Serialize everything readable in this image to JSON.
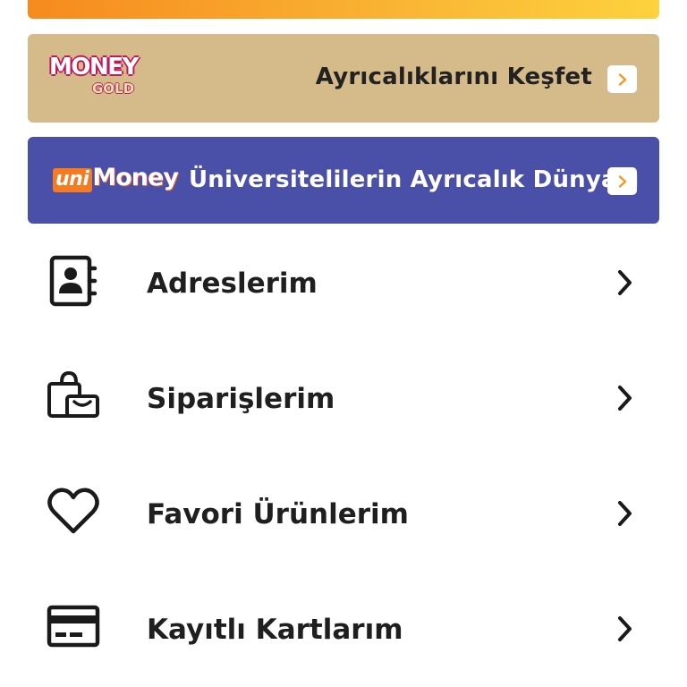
{
  "colors": {
    "gold_banner": "#d5bb8a",
    "uni_banner": "#4a4fa8",
    "accent_orange": "#f68a1e",
    "text_dark": "#1f1f1f"
  },
  "gold_promo": {
    "logo_main": "MONEY",
    "logo_sub": "GOLD",
    "text": "Ayrıcalıklarını Keşfet",
    "arrow_icon": "chevron-right-icon"
  },
  "uni_promo": {
    "logo_prefix": "uni",
    "logo_main": "Money",
    "text": "Üniversitelilerin Ayrıcalık Dünyası",
    "arrow_icon": "chevron-right-icon"
  },
  "menu": {
    "items": [
      {
        "label": "Adreslerim",
        "icon": "address-book-icon"
      },
      {
        "label": "Siparişlerim",
        "icon": "shopping-bag-icon"
      },
      {
        "label": "Favori Ürünlerim",
        "icon": "heart-icon"
      },
      {
        "label": "Kayıtlı Kartlarım",
        "icon": "credit-card-icon"
      }
    ]
  }
}
